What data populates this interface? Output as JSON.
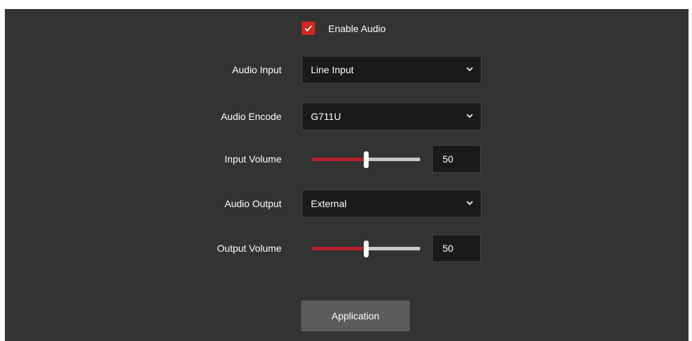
{
  "enable_audio": {
    "label": "Enable Audio",
    "checked": true
  },
  "audio_input": {
    "label": "Audio Input",
    "value": "Line Input"
  },
  "audio_encode": {
    "label": "Audio Encode",
    "value": "G711U"
  },
  "input_volume": {
    "label": "Input Volume",
    "value": "50",
    "level": 0.5
  },
  "audio_output": {
    "label": "Audio Output",
    "value": "External"
  },
  "output_volume": {
    "label": "Output Volume",
    "value": "50",
    "level": 0.5
  },
  "apply_button": {
    "label": "Application"
  },
  "colors": {
    "panel": "#333333",
    "accent": "#d7261e",
    "slider_fill": "#b5202a",
    "button": "#5c5c5c"
  },
  "icons": {
    "checkbox": "checkmark-icon",
    "dropdown": "chevron-down-icon"
  }
}
